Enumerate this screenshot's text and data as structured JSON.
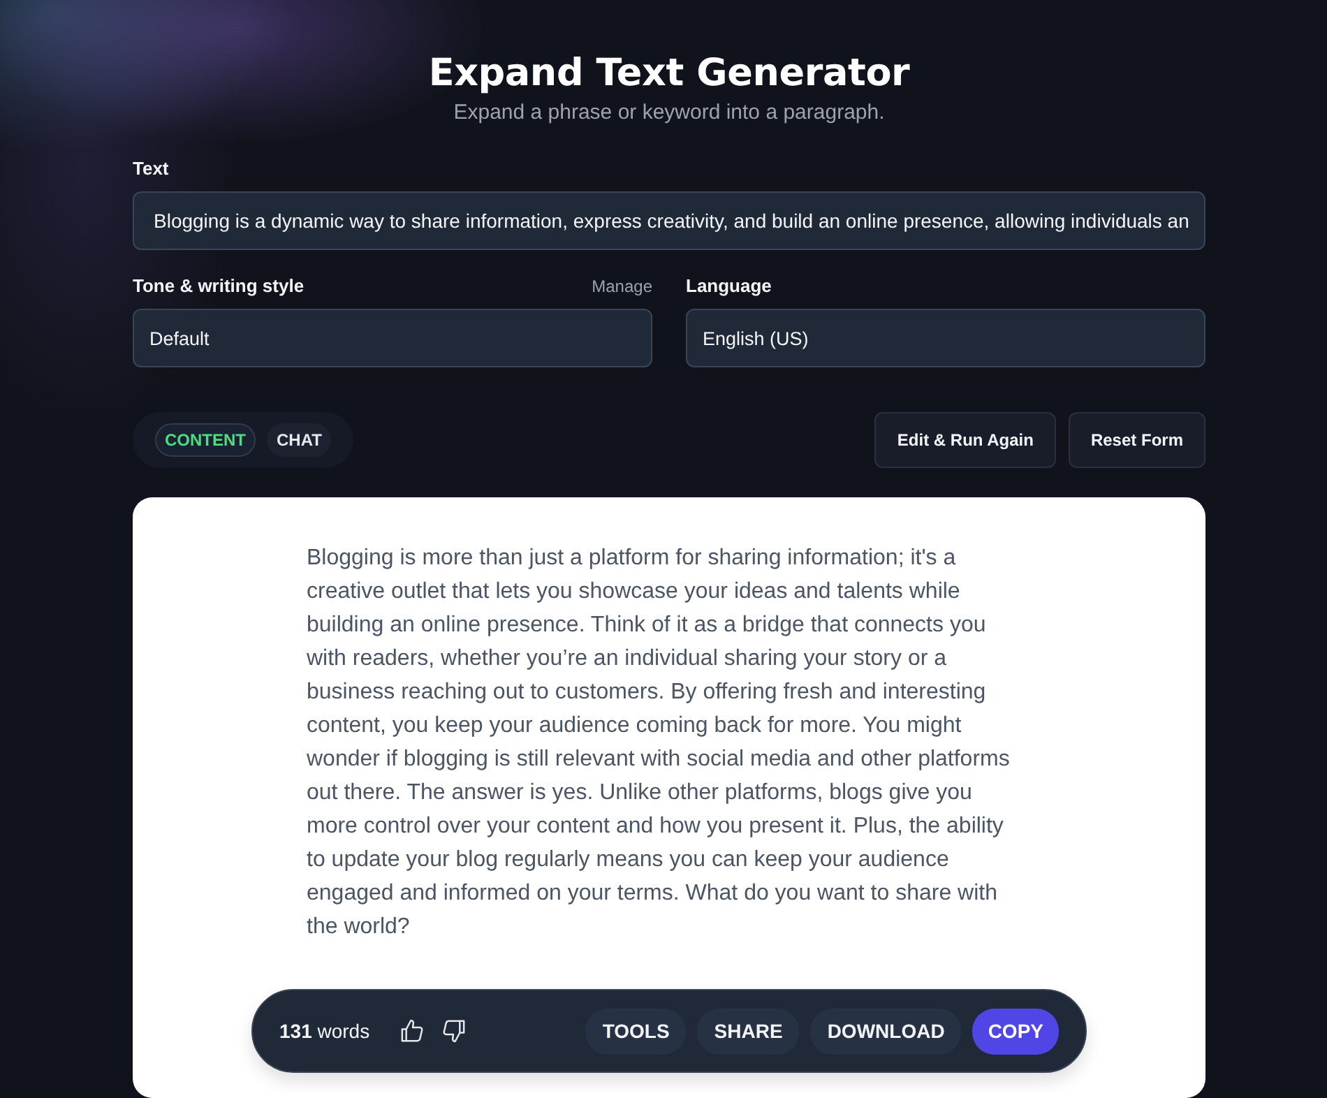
{
  "header": {
    "title": "Expand Text Generator",
    "subtitle": "Expand a phrase or keyword into a paragraph."
  },
  "text_field": {
    "label": "Text",
    "value": "Blogging is a dynamic way to share information, express creativity, and build an online presence, allowing individuals an"
  },
  "tone_field": {
    "label": "Tone & writing style",
    "link": "Manage",
    "value": "Default"
  },
  "language_field": {
    "label": "Language",
    "value": "English (US)"
  },
  "view_tabs": [
    {
      "label": "CONTENT",
      "selected": true
    },
    {
      "label": "CHAT",
      "selected": false
    }
  ],
  "actions": [
    "Edit & Run Again",
    "Reset Form"
  ],
  "output": {
    "text": "Blogging is more than just a platform for sharing information; it's a creative outlet that lets you showcase your ideas and talents while building an online presence. Think of it as a bridge that connects you with readers, whether you’re an individual sharing your story or a business reaching out to customers. By offering fresh and interesting content, you keep your audience coming back for more. You might wonder if blogging is still relevant with social media and other platforms out there. The answer is yes. Unlike other platforms, blogs give you more control over your content and how you present it. Plus, the ability to update your blog regularly means you can keep your audience engaged and informed on your terms. What do you want to share with the world?"
  },
  "toolbar": {
    "word_count": "**131** words",
    "buttons": [
      {
        "label": "TOOLS",
        "kind": "secondary"
      },
      {
        "label": "SHARE",
        "kind": "secondary"
      },
      {
        "label": "DOWNLOAD",
        "kind": "secondary"
      },
      {
        "label": "COPY",
        "kind": "primary"
      }
    ]
  }
}
